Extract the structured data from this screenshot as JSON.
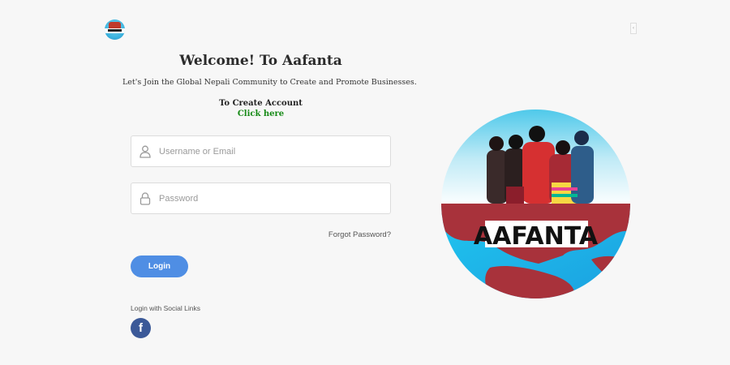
{
  "header": {
    "logo_icon": "aafanta-logo-icon",
    "corner_glyph": "‹"
  },
  "main": {
    "title": "Welcome! To Aafanta",
    "subtitle": "Let's Join the Global Nepali Community to Create and Promote Businesses.",
    "create_account_label": "To Create Account",
    "create_account_link": "Click here"
  },
  "form": {
    "username": {
      "placeholder": "Username or Email",
      "value": "",
      "icon": "user-icon"
    },
    "password": {
      "placeholder": "Password",
      "value": "",
      "icon": "lock-icon"
    },
    "forgot_password": "Forgot Password?",
    "login_label": "Login"
  },
  "social": {
    "label": "Login with Social Links",
    "facebook_glyph": "f",
    "facebook_icon": "facebook-icon"
  },
  "hero": {
    "brand_text": "AAFANTA"
  },
  "colors": {
    "accent": "#4f8ee4",
    "link_green": "#178a17",
    "facebook": "#3b5998",
    "background": "#f7f7f7"
  }
}
